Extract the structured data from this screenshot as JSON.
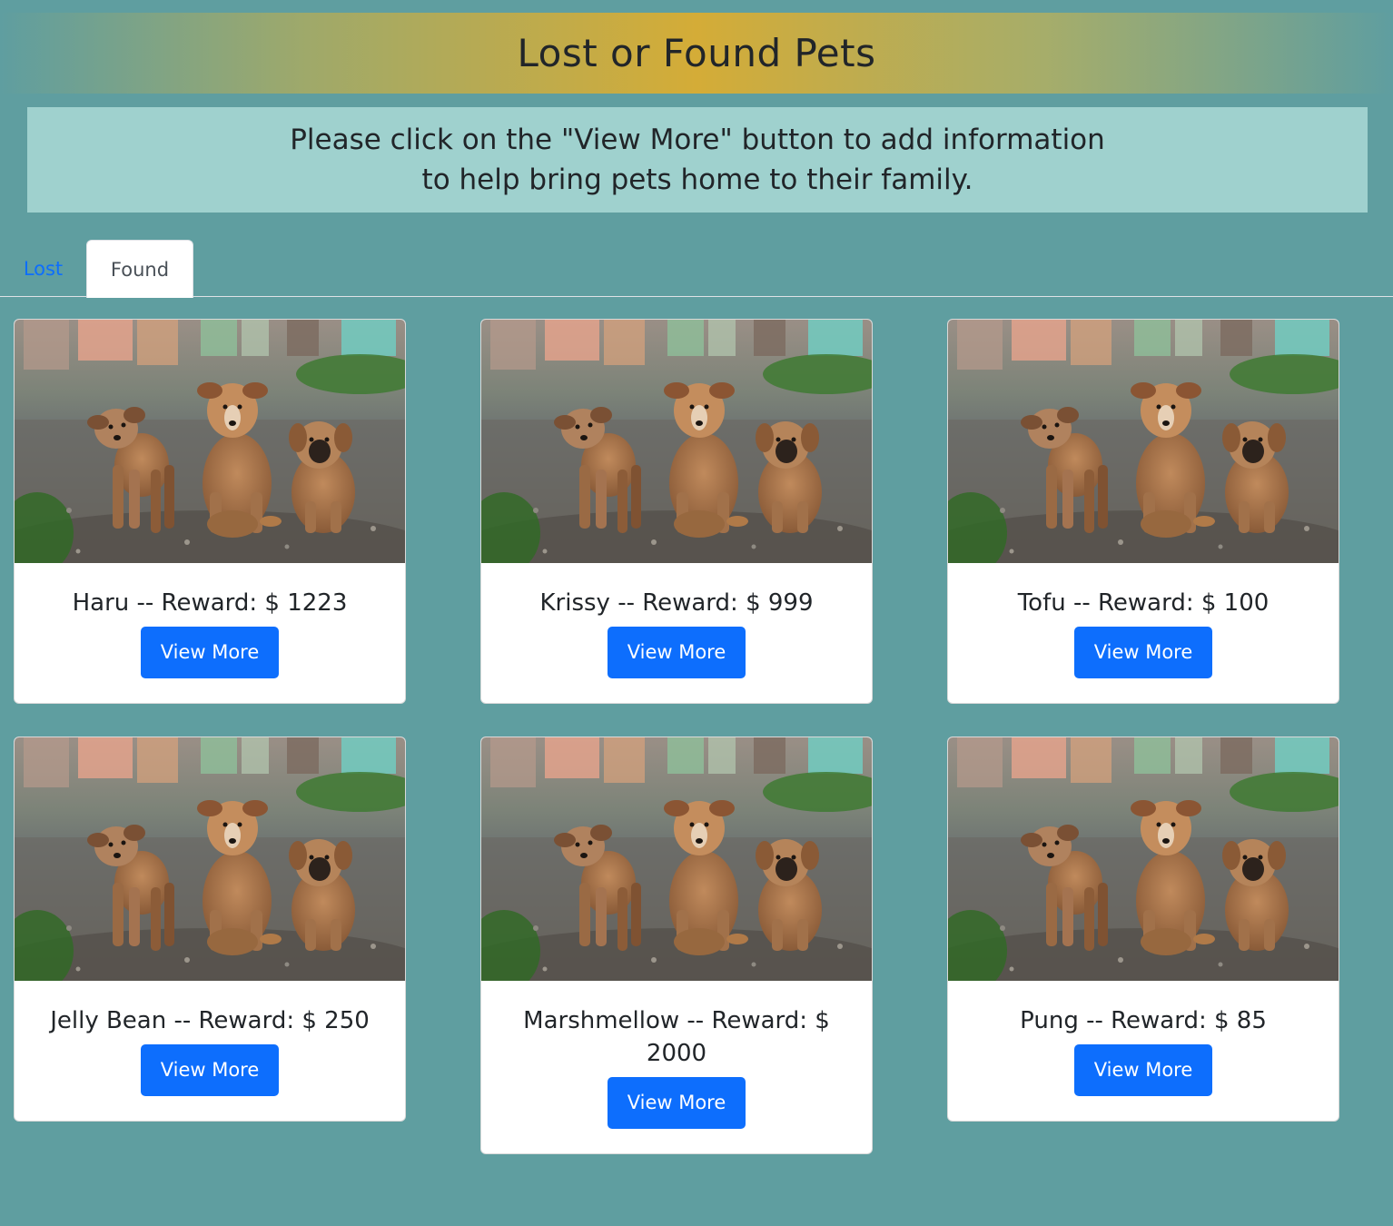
{
  "header": {
    "title": "Lost or Found Pets"
  },
  "notice": {
    "line1": "Please click on the \"View More\" button to add information",
    "line2": "to help bring pets home to their family."
  },
  "tabs": [
    {
      "label": "Lost",
      "active": false
    },
    {
      "label": "Found",
      "active": true
    }
  ],
  "cards": [
    {
      "title": "Haru -- Reward: $ 1223",
      "button": "View More",
      "photo": "three-puppies-photo"
    },
    {
      "title": "Krissy -- Reward: $ 999",
      "button": "View More",
      "photo": "three-puppies-photo"
    },
    {
      "title": "Tofu -- Reward: $ 100",
      "button": "View More",
      "photo": "three-puppies-photo"
    },
    {
      "title": "Jelly Bean -- Reward: $ 250",
      "button": "View More",
      "photo": "three-puppies-photo"
    },
    {
      "title": "Marshmellow -- Reward: $ 2000",
      "button": "View More",
      "photo": "three-puppies-photo"
    },
    {
      "title": "Pung -- Reward: $ 85",
      "button": "View More",
      "photo": "three-puppies-photo"
    }
  ],
  "colors": {
    "page_background": "#5f9ea0",
    "banner_center": "#d4ac37",
    "notice_background": "#9fd1ce",
    "button": "#0d6efd",
    "tab_link": "#0d6efd"
  }
}
